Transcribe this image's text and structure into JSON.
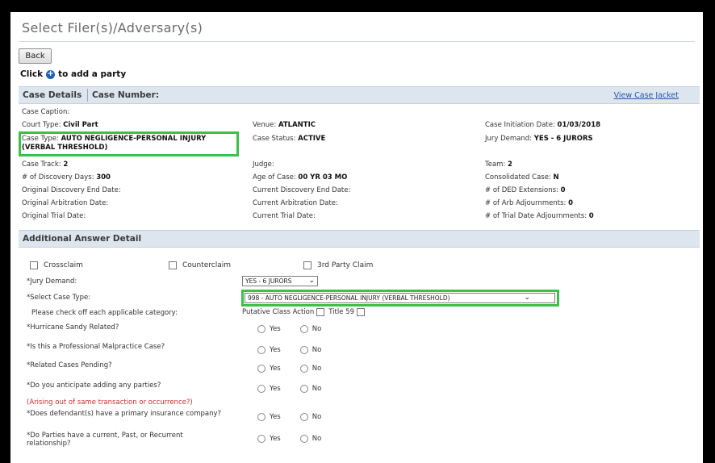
{
  "header": {
    "title": "Select Filer(s)/Adversary(s)",
    "back_label": "Back",
    "click_prefix": "Click",
    "click_suffix": "to add a party"
  },
  "case_details": {
    "section_title_left": "Case Details",
    "section_title_right": "Case Number:",
    "view_case_jacket": "View Case Jacket",
    "rows": [
      {
        "c1_label": "Case Caption:",
        "c1_value": "",
        "c2_label": "",
        "c2_value": "",
        "c3_label": "",
        "c3_value": ""
      },
      {
        "c1_label": "Court Type:",
        "c1_value": "Civil Part",
        "c2_label": "Venue:",
        "c2_value": "ATLANTIC",
        "c3_label": "Case Initiation Date:",
        "c3_value": "01/03/2018"
      },
      {
        "c1_label": "Case Type:",
        "c1_value": "AUTO NEGLIGENCE-PERSONAL INJURY",
        "c1_value2": "(VERBAL THRESHOLD)",
        "c2_label": "Case Status:",
        "c2_value": "ACTIVE",
        "c3_label": "Jury Demand:",
        "c3_value": "YES - 6 JURORS"
      },
      {
        "c1_label": "Case Track:",
        "c1_value": "2",
        "c2_label": "Judge:",
        "c2_value": "",
        "c3_label": "Team:",
        "c3_value": "2"
      },
      {
        "c1_label": "# of Discovery Days:",
        "c1_value": "300",
        "c2_label": "Age of Case:",
        "c2_value": "00 YR 03 MO",
        "c3_label": "Consolidated Case:",
        "c3_value": "N"
      },
      {
        "c1_label": "Original Discovery End Date:",
        "c1_value": "",
        "c2_label": "Current Discovery End Date:",
        "c2_value": "",
        "c3_label": "# of DED Extensions:",
        "c3_value": "0"
      },
      {
        "c1_label": "Original Arbitration Date:",
        "c1_value": "",
        "c2_label": "Current Arbitration Date:",
        "c2_value": "",
        "c3_label": "# of Arb Adjournments:",
        "c3_value": "0"
      },
      {
        "c1_label": "Original Trial Date:",
        "c1_value": "",
        "c2_label": "Current Trial Date:",
        "c2_value": "",
        "c3_label": "# of Trial Date Adjournments:",
        "c3_value": "0"
      }
    ]
  },
  "answer_detail": {
    "section_title": "Additional Answer Detail",
    "crossclaim": "Crossclaim",
    "counterclaim": "Counterclaim",
    "third_party": "3rd Party Claim",
    "jury_demand_label": "*Jury Demand:",
    "jury_demand_value": "YES - 6 JURORS",
    "case_type_label": "*Select Case Type:",
    "case_type_value": "998 - AUTO NEGLIGENCE-PERSONAL INJURY (VERBAL THRESHOLD)",
    "category_label": "Please check off each applicable category:",
    "putative_label": "Putative Class Action",
    "title59_label": "Title 59",
    "yes": "Yes",
    "no": "No",
    "questions": [
      "*Hurricane Sandy Related?",
      "*Is this a Professional Malpractice Case?",
      "*Related Cases Pending?",
      "*Do you anticipate adding any parties?",
      "*Does defendant(s) have a primary insurance company?",
      "*Do Parties have a current, Past, or Recurrent"
    ],
    "q6_line2": "relationship?",
    "red_note": "(Arising out of same transaction or occurrence?)"
  }
}
